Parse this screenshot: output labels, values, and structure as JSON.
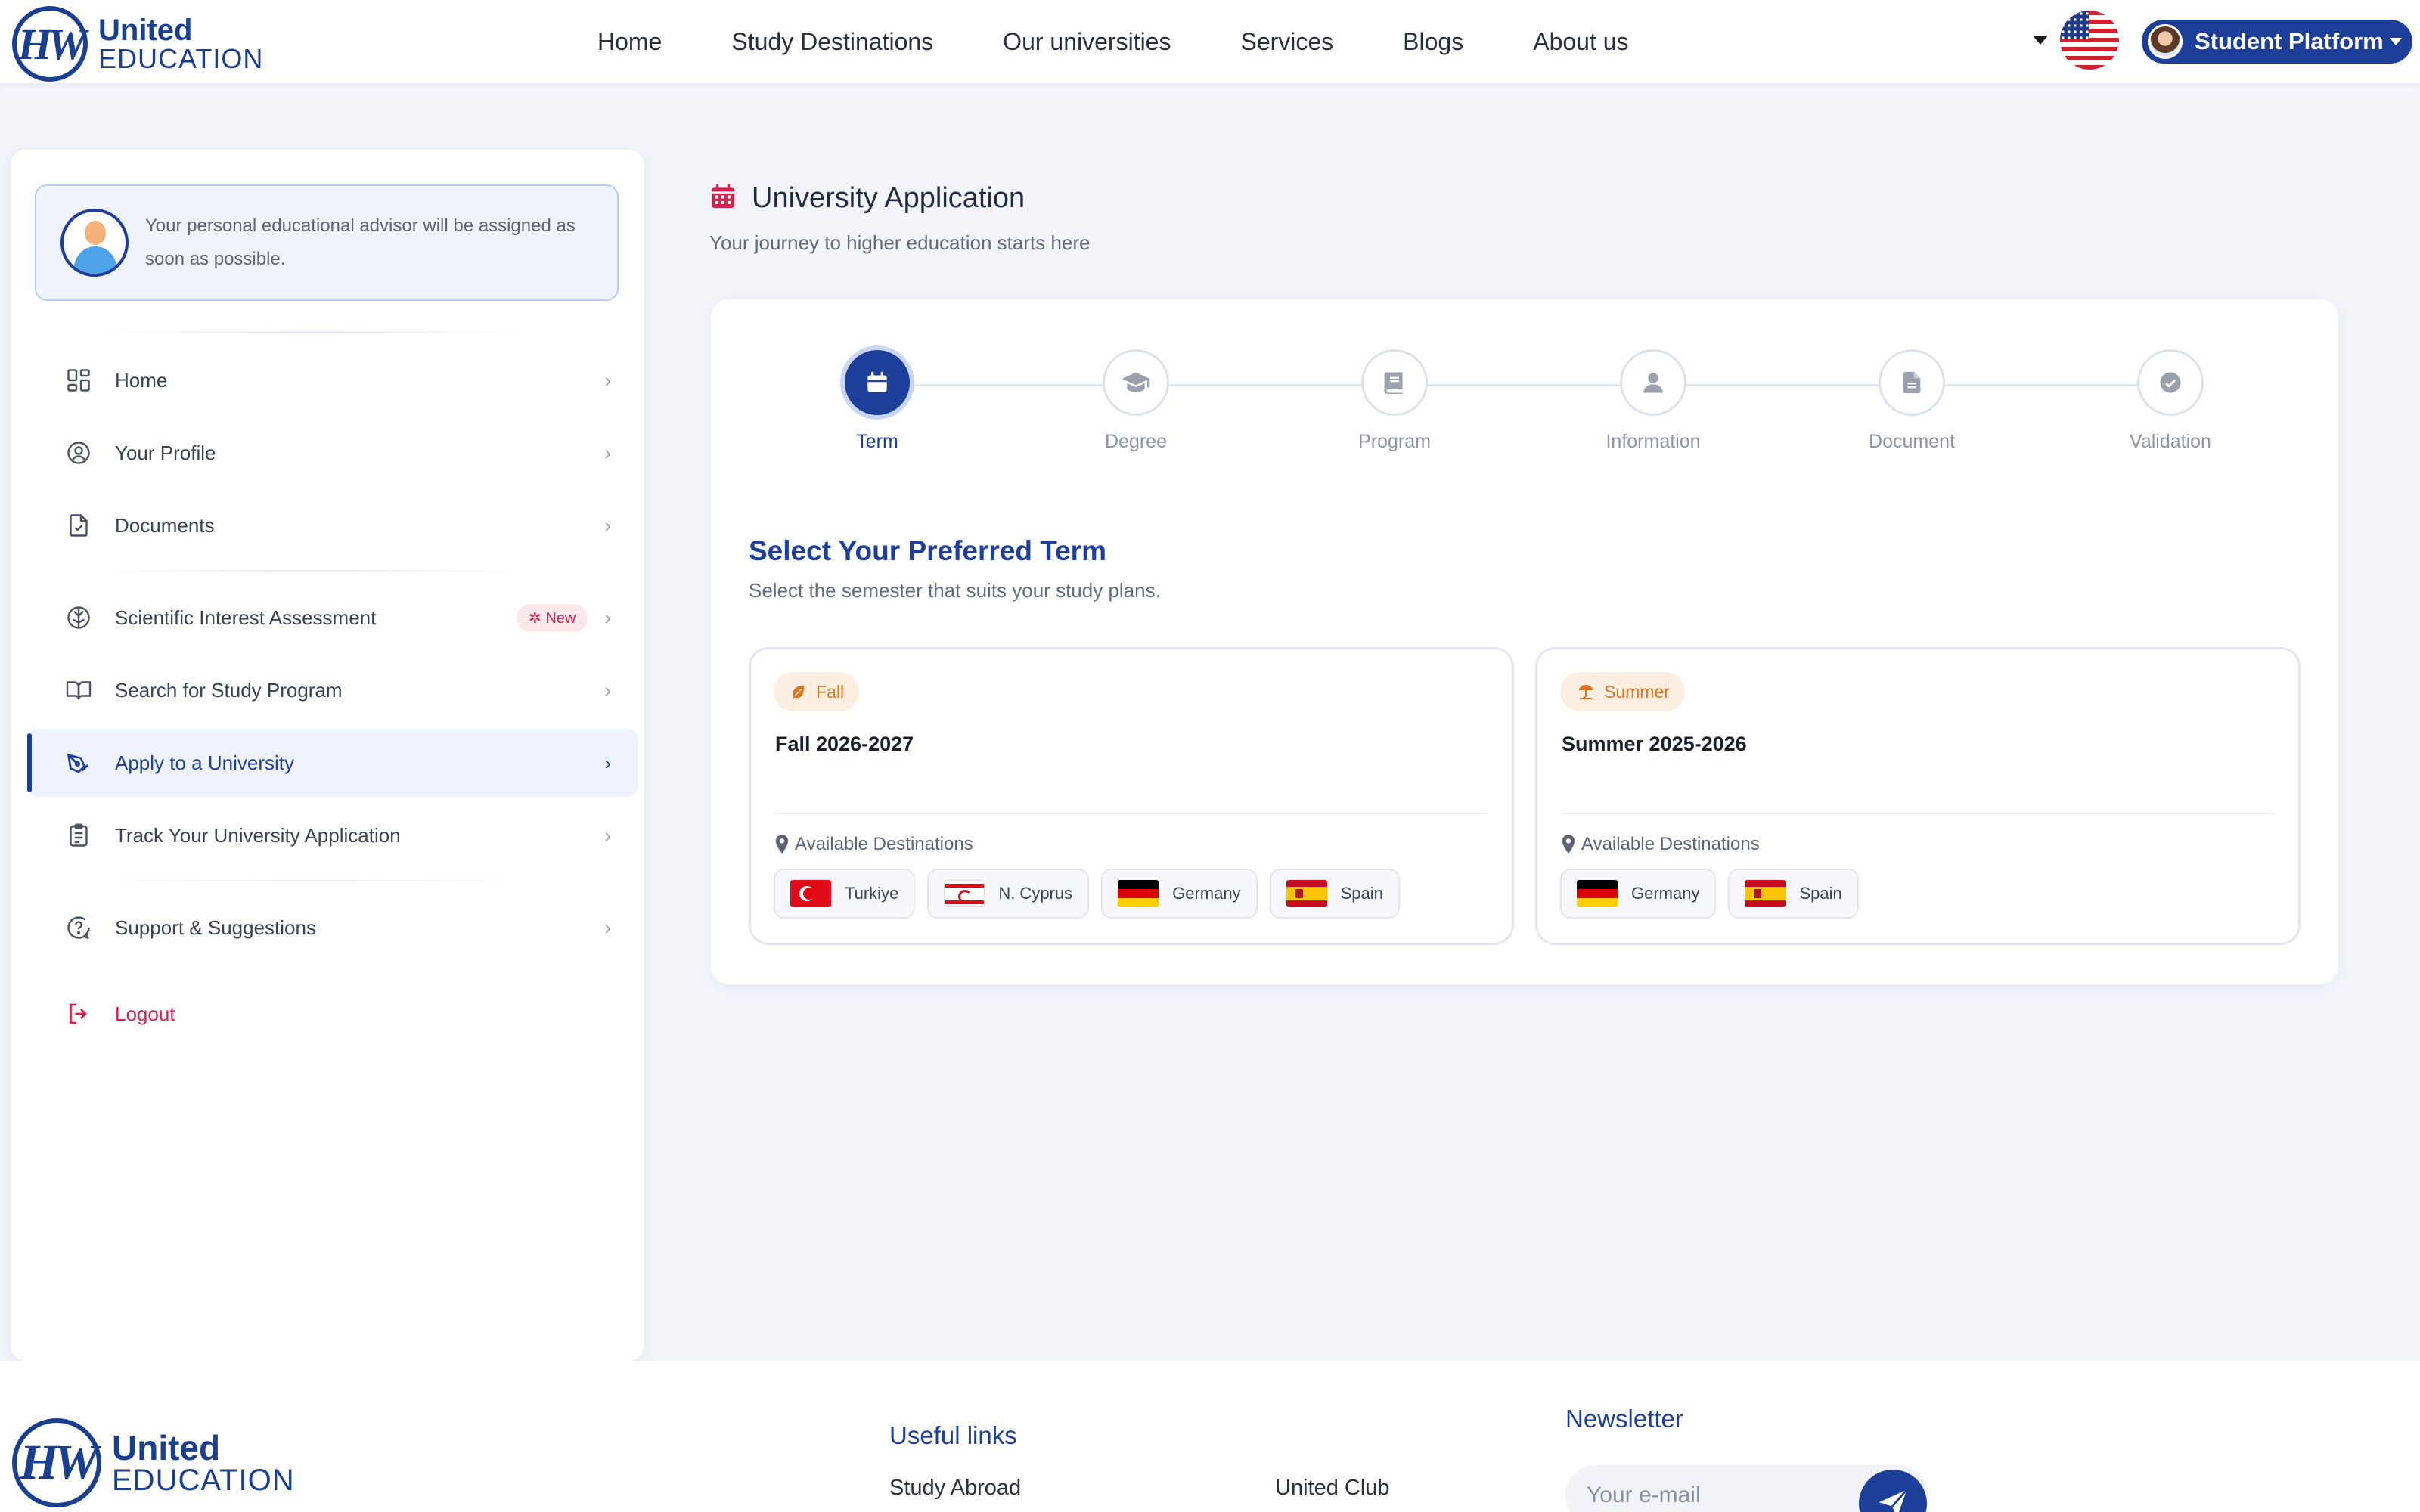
{
  "brand": {
    "line1": "United",
    "line2": "EDUCATION",
    "mark": "HW"
  },
  "nav": [
    {
      "label": "Home"
    },
    {
      "label": "Study Destinations"
    },
    {
      "label": "Our universities"
    },
    {
      "label": "Services"
    },
    {
      "label": "Blogs"
    },
    {
      "label": "About us"
    }
  ],
  "header": {
    "language_icon": "us-flag-icon",
    "platform_button": "Student Platform"
  },
  "sidebar": {
    "advisor_text": "Your personal educational advisor will be assigned as soon as possible.",
    "items": [
      {
        "label": "Home",
        "icon": "grid-icon"
      },
      {
        "label": "Your Profile",
        "icon": "user-circle-icon"
      },
      {
        "label": "Documents",
        "icon": "file-check-icon"
      },
      {
        "label": "Scientific Interest Assessment",
        "icon": "brain-icon",
        "badge": "New"
      },
      {
        "label": "Search for Study Program",
        "icon": "book-open-icon"
      },
      {
        "label": "Apply to a University",
        "icon": "pen-tool-icon",
        "active": true
      },
      {
        "label": "Track Your University Application",
        "icon": "clipboard-icon"
      },
      {
        "label": "Support & Suggestions",
        "icon": "help-circle-icon"
      },
      {
        "label": "Logout",
        "icon": "logout-icon"
      }
    ]
  },
  "main": {
    "title": "University Application",
    "subtitle": "Your journey to higher education starts here",
    "steps": [
      {
        "label": "Term",
        "icon": "calendar-icon",
        "active": true
      },
      {
        "label": "Degree",
        "icon": "graduation-cap-icon"
      },
      {
        "label": "Program",
        "icon": "book-icon"
      },
      {
        "label": "Information",
        "icon": "user-icon"
      },
      {
        "label": "Document",
        "icon": "document-icon"
      },
      {
        "label": "Validation",
        "icon": "check-circle-icon"
      }
    ],
    "section_title": "Select Your Preferred Term",
    "section_subtitle": "Select the semester that suits your study plans.",
    "terms": [
      {
        "badge": "Fall",
        "name": "Fall 2026-2027",
        "destinations_label": "Available Destinations",
        "destinations": [
          "Turkiye",
          "N. Cyprus",
          "Germany",
          "Spain"
        ]
      },
      {
        "badge": "Summer",
        "name": "Summer 2025-2026",
        "destinations_label": "Available Destinations",
        "destinations": [
          "Germany",
          "Spain"
        ]
      }
    ]
  },
  "footer": {
    "useful_links_title": "Useful links",
    "links": [
      "Study Abroad",
      "United Club"
    ],
    "newsletter_title": "Newsletter",
    "newsletter_placeholder": "Your e-mail"
  },
  "colors": {
    "primary": "#1d3f99",
    "accent": "#d4204a",
    "orange": "#e0731d",
    "background": "#f3f5fb"
  }
}
